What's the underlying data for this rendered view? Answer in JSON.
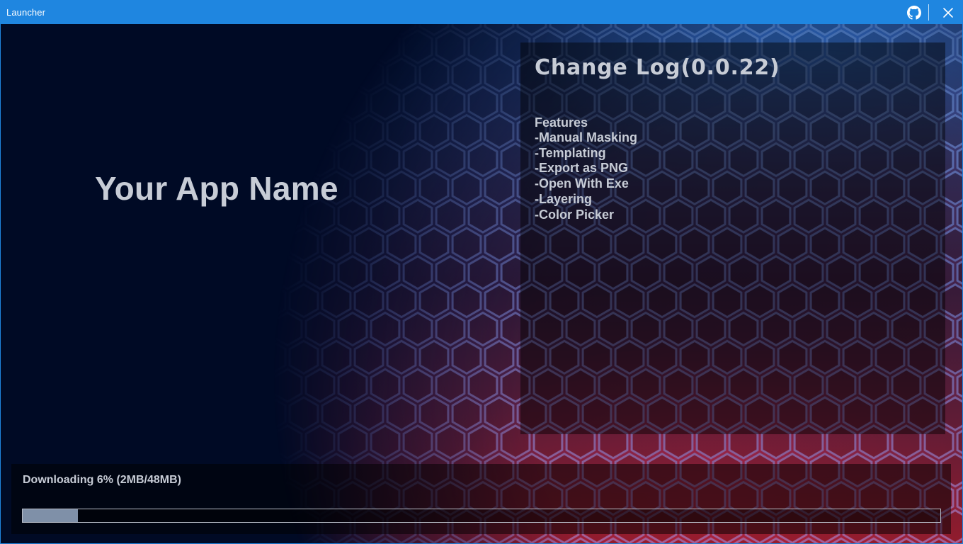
{
  "window": {
    "title": "Launcher",
    "accent_color": "#1f86e0"
  },
  "titlebar": {
    "github_icon": "github-icon",
    "close_icon": "close-icon"
  },
  "app": {
    "name": "Your App Name"
  },
  "changelog": {
    "title": "Change Log(0.0.22)",
    "section_title": "Features",
    "items": [
      "-Manual Masking",
      "-Templating",
      "-Export as PNG",
      "-Open With Exe",
      "-Layering",
      "-Color Picker"
    ]
  },
  "download": {
    "status": "Downloading 6% (2MB/48MB)",
    "progress_fraction": 0.06,
    "downloaded": "2MB",
    "total": "48MB",
    "bar_fill_color": "#7f90a8"
  }
}
